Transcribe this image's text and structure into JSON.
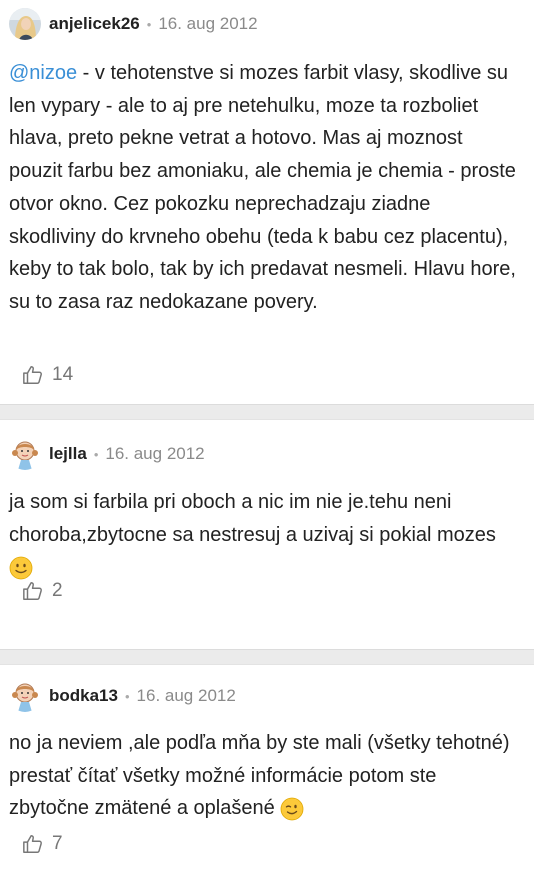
{
  "comments": [
    {
      "username": "anjelicek26",
      "separator": "•",
      "date": "16. aug 2012",
      "mention": "@nizoe",
      "text": " - v tehotenstve si mozes farbit vlasy, skodlive su len vypary - ale to aj pre netehulku, moze ta rozboliet hlava, preto pekne vetrat a hotovo. Mas aj moznost pouzit farbu bez amoniaku, ale chemia je chemia - proste otvor okno. Cez pokozku neprechadzaju ziadne skodliviny do krvneho obehu (teda k babu cez placentu), keby to tak bolo, tak by ich predavat nesmeli. Hlavu hore, su to zasa raz nedokazane povery.",
      "likes": "14",
      "like_icon": "thumbs-up-outline-icon"
    },
    {
      "username": "lejlla",
      "separator": "•",
      "date": "16. aug 2012",
      "text": "ja som si farbila pri oboch a nic im nie je.tehu neni choroba,zbytocne sa nestresuj a uzivaj si pokial mozes",
      "emoji": "slightly-smiling-face-icon",
      "likes": "2",
      "like_icon": "thumbs-up-outline-icon"
    },
    {
      "username": "bodka13",
      "separator": "•",
      "date": "16. aug 2012",
      "text": "no ja neviem ,ale podľa mňa by ste mali (všetky tehotné) prestať čítať všetky možné informácie potom ste zbytočne zmätené a oplašené",
      "emoji": "winking-face-icon",
      "likes": "7",
      "like_icon": "thumbs-up-outline-icon"
    }
  ],
  "colors": {
    "mention": "#3a8fd6",
    "date": "#8a8a8a",
    "separator_band": "#ebebeb"
  }
}
